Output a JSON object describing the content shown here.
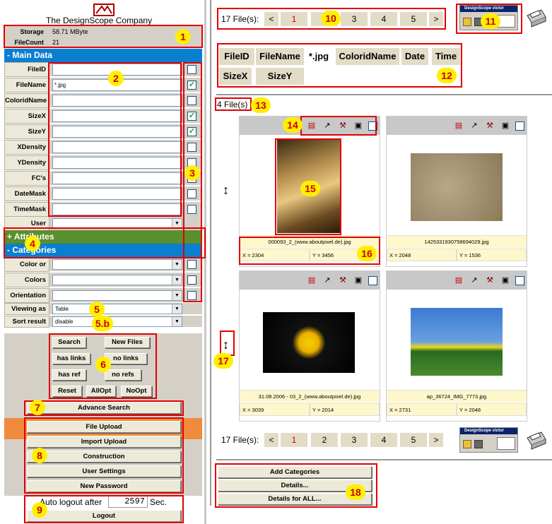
{
  "company": {
    "name": "The DesignScope Company"
  },
  "stats": [
    {
      "label": "Storage",
      "value": "58.71 MByte"
    },
    {
      "label": "FileCount",
      "value": "21"
    }
  ],
  "sections": {
    "main": "- Main Data",
    "attributes": "+ Attributes",
    "categories": "- Categories"
  },
  "fields": [
    {
      "label": "FileID",
      "value": "",
      "checked": false
    },
    {
      "label": "FileName",
      "value": "*.jpg",
      "checked": true
    },
    {
      "label": "ColoridName",
      "value": "",
      "checked": false
    },
    {
      "label": "SizeX",
      "value": "",
      "checked": true
    },
    {
      "label": "SizeY",
      "value": "",
      "checked": true
    },
    {
      "label": "XDensity",
      "value": "",
      "checked": false
    },
    {
      "label": "YDensity",
      "value": "",
      "checked": false
    },
    {
      "label": "FC's",
      "value": "",
      "checked": false
    },
    {
      "label": "DateMask",
      "value": "",
      "checked": false
    },
    {
      "label": "TimeMask",
      "value": "",
      "checked": false
    }
  ],
  "user_field": {
    "label": "User",
    "value": ""
  },
  "category_fields": [
    {
      "label": "Color or B/W",
      "value": ""
    },
    {
      "label": "Colors",
      "value": ""
    },
    {
      "label": "Orientation",
      "value": ""
    }
  ],
  "viewing": {
    "label": "Viewing as",
    "value": "Table"
  },
  "sort": {
    "label": "Sort result",
    "value": "disable"
  },
  "search_buttons": [
    "Search",
    "New Files",
    "has links",
    "no links",
    "has ref",
    "no refs",
    "Reset",
    "AllOpt",
    "NoOpt"
  ],
  "advance_search": "Advance Search",
  "action_buttons": [
    "File Upload",
    "Import Upload",
    "Construction",
    "User Settings",
    "New Password"
  ],
  "logout": {
    "label": "Auto logout after",
    "seconds": "2597",
    "unit": "Sec.",
    "button": "Logout"
  },
  "pagination": {
    "count_label": "17 File(s):",
    "prev": "<",
    "next": ">",
    "pages": [
      "1",
      "2",
      "3",
      "4",
      "5"
    ],
    "current": "1"
  },
  "result_fields": [
    "FileID",
    "FileName",
    "*.jpg",
    "ColoridName",
    "Date",
    "Time",
    "SizeX",
    "SizeY"
  ],
  "result_count": "4 File(s)",
  "victor": {
    "title": "DesignScope victor"
  },
  "files": [
    {
      "name": "000093_2_(www.aboutpixel.de).jpg",
      "x": "X = 2304",
      "y": "Y = 3456"
    },
    {
      "name": "1425331930758694029.jpg",
      "x": "X = 2048",
      "y": "Y = 1536"
    },
    {
      "name": "31.08.2006 - 03_2_(www.aboutpixel.de).jpg",
      "x": "X = 3039",
      "y": "Y = 2014"
    },
    {
      "name": "ap_36724_IMG_7773.jpg",
      "x": "X = 2731",
      "y": "Y = 2048"
    }
  ],
  "bottom_buttons": [
    "Add Categories",
    "Details...",
    "Details for ALL..."
  ],
  "callouts": [
    "1",
    "2",
    "3",
    "4",
    "5",
    "5.b",
    "6",
    "7",
    "8",
    "9",
    "10",
    "11",
    "12",
    "13",
    "14",
    "15",
    "16",
    "17",
    "18"
  ],
  "colors": {
    "section_blue": "#0a7fd0",
    "attributes_green": "#5a8f2d",
    "orange_band": "#f08a3c",
    "callout_red": "#e20000",
    "callout_yellow": "#ffef00",
    "tan": "#e2dbc6"
  }
}
